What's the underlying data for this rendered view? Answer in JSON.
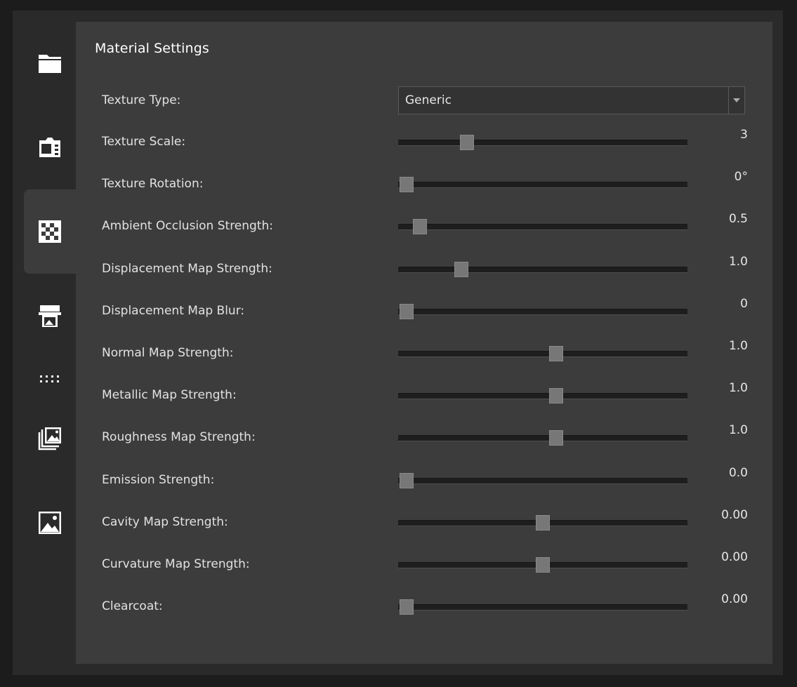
{
  "sidebar": {
    "items": [
      {
        "icon": "folder-icon"
      },
      {
        "icon": "camera-icon"
      },
      {
        "icon": "checkerboard-texture-icon"
      },
      {
        "icon": "printer-icon"
      },
      {
        "icon": "dots-grid-icon"
      },
      {
        "icon": "image-stack-icon"
      },
      {
        "icon": "image-icon"
      }
    ]
  },
  "panel": {
    "title": "Material Settings",
    "texture_type": {
      "label": "Texture Type:",
      "value": "Generic"
    },
    "sliders": [
      {
        "label": "Texture Scale:",
        "value": "3",
        "position": 0.237
      },
      {
        "label": "Texture Rotation:",
        "value": "0°",
        "position": 0.029
      },
      {
        "label": "Ambient Occlusion Strength:",
        "value": "0.5",
        "position": 0.076
      },
      {
        "label": "Displacement Map Strength:",
        "value": "1.0",
        "position": 0.218
      },
      {
        "label": "Displacement Map Blur:",
        "value": "0",
        "position": 0.029
      },
      {
        "label": "Normal Map Strength:",
        "value": "1.0",
        "position": 0.546
      },
      {
        "label": "Metallic Map Strength:",
        "value": "1.0",
        "position": 0.546
      },
      {
        "label": "Roughness Map Strength:",
        "value": "1.0",
        "position": 0.546
      },
      {
        "label": "Emission Strength:",
        "value": "0.0",
        "position": 0.029
      },
      {
        "label": "Cavity Map Strength:",
        "value": "0.00",
        "position": 0.5
      },
      {
        "label": "Curvature Map Strength:",
        "value": "0.00",
        "position": 0.5
      },
      {
        "label": "Clearcoat:",
        "value": "0.00",
        "position": 0.029
      }
    ]
  }
}
